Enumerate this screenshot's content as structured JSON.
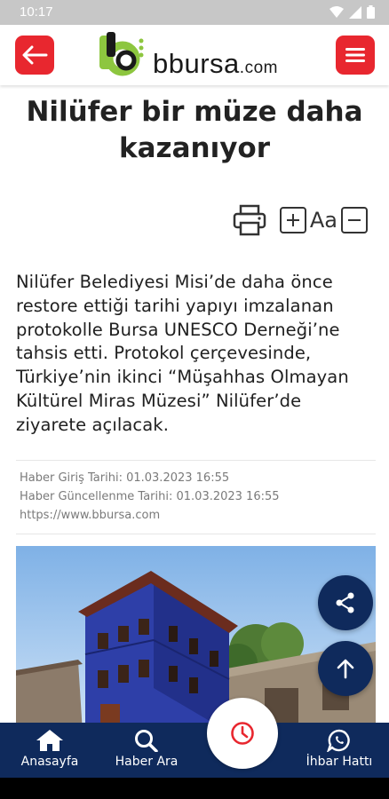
{
  "status_bar": {
    "time": "10:17"
  },
  "header": {
    "logo_text": "bbursa",
    "logo_suffix": ".com"
  },
  "article": {
    "title_line1": "Nilüfer bir müze daha",
    "title_line2": "kazanıyor",
    "font_size_label": "Aa",
    "summary": "Nilüfer Belediyesi Misi’de daha önce restore ettiği tarihi yapıyı imzalanan protokolle Bursa UNESCO Derneği’ne tahsis etti. Protokol çerçevesinde, Türkiye’nin ikinci “Müşahhas Olmayan Kültürel Miras Müzesi” Nilüfer’de ziyarete açılacak.",
    "meta": {
      "published": "Haber Giriş Tarihi: 01.03.2023 16:55",
      "updated": "Haber Güncellenme Tarihi: 01.03.2023 16:55",
      "source": "https://www.bbursa.com"
    }
  },
  "bottom_nav": {
    "items": [
      {
        "label": "Anasayfa",
        "icon": "home-icon"
      },
      {
        "label": "Haber Ara",
        "icon": "search-icon"
      },
      {
        "label": "",
        "icon": "clock-icon"
      },
      {
        "label": "İhbar Hattı",
        "icon": "whatsapp-icon"
      }
    ]
  },
  "colors": {
    "brand_red": "#e8272f",
    "navy": "#0f2a5c",
    "logo_green": "#8dc63f",
    "status_bar": "#c7c7c7"
  }
}
